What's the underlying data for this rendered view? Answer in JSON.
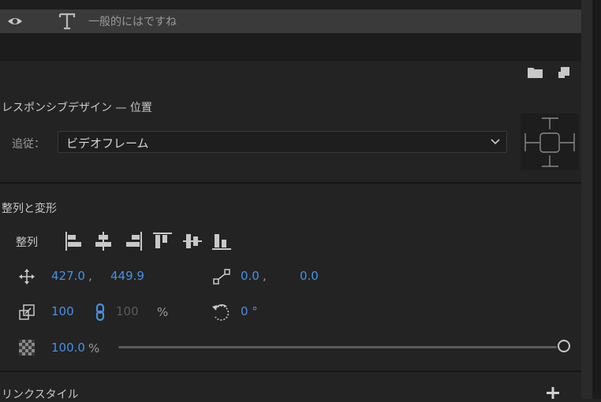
{
  "layer": {
    "name": "一般的にはですね"
  },
  "sections": {
    "responsive_title": "レスポンシブデザイン — 位置",
    "follow_label": "追従：",
    "follow_value": "ビデオフレーム",
    "align_transform_title": "整列と変形",
    "align_label": "整列",
    "link_styles_title": "リンクスタイル"
  },
  "transform": {
    "position_x": "427.0",
    "position_sep": ",",
    "position_y": "449.9",
    "anchor_x": "0.0",
    "anchor_sep": ",",
    "anchor_y": "0.0",
    "scale": "100",
    "scale_height": "100",
    "scale_unit": "%",
    "rotation": "0 °",
    "opacity": "100.0",
    "opacity_unit": "%",
    "opacity_level": 1.0
  },
  "icons": {
    "visibility": "eye-icon",
    "layer_type": "text-tool-icon",
    "folder": "folder-icon",
    "new_item": "new-item-icon",
    "link": "link-chain-icon",
    "add": "plus-icon"
  },
  "colors": {
    "accent": "#4b8fe0",
    "background": "#232323",
    "row_highlight": "#3a3a3a"
  }
}
